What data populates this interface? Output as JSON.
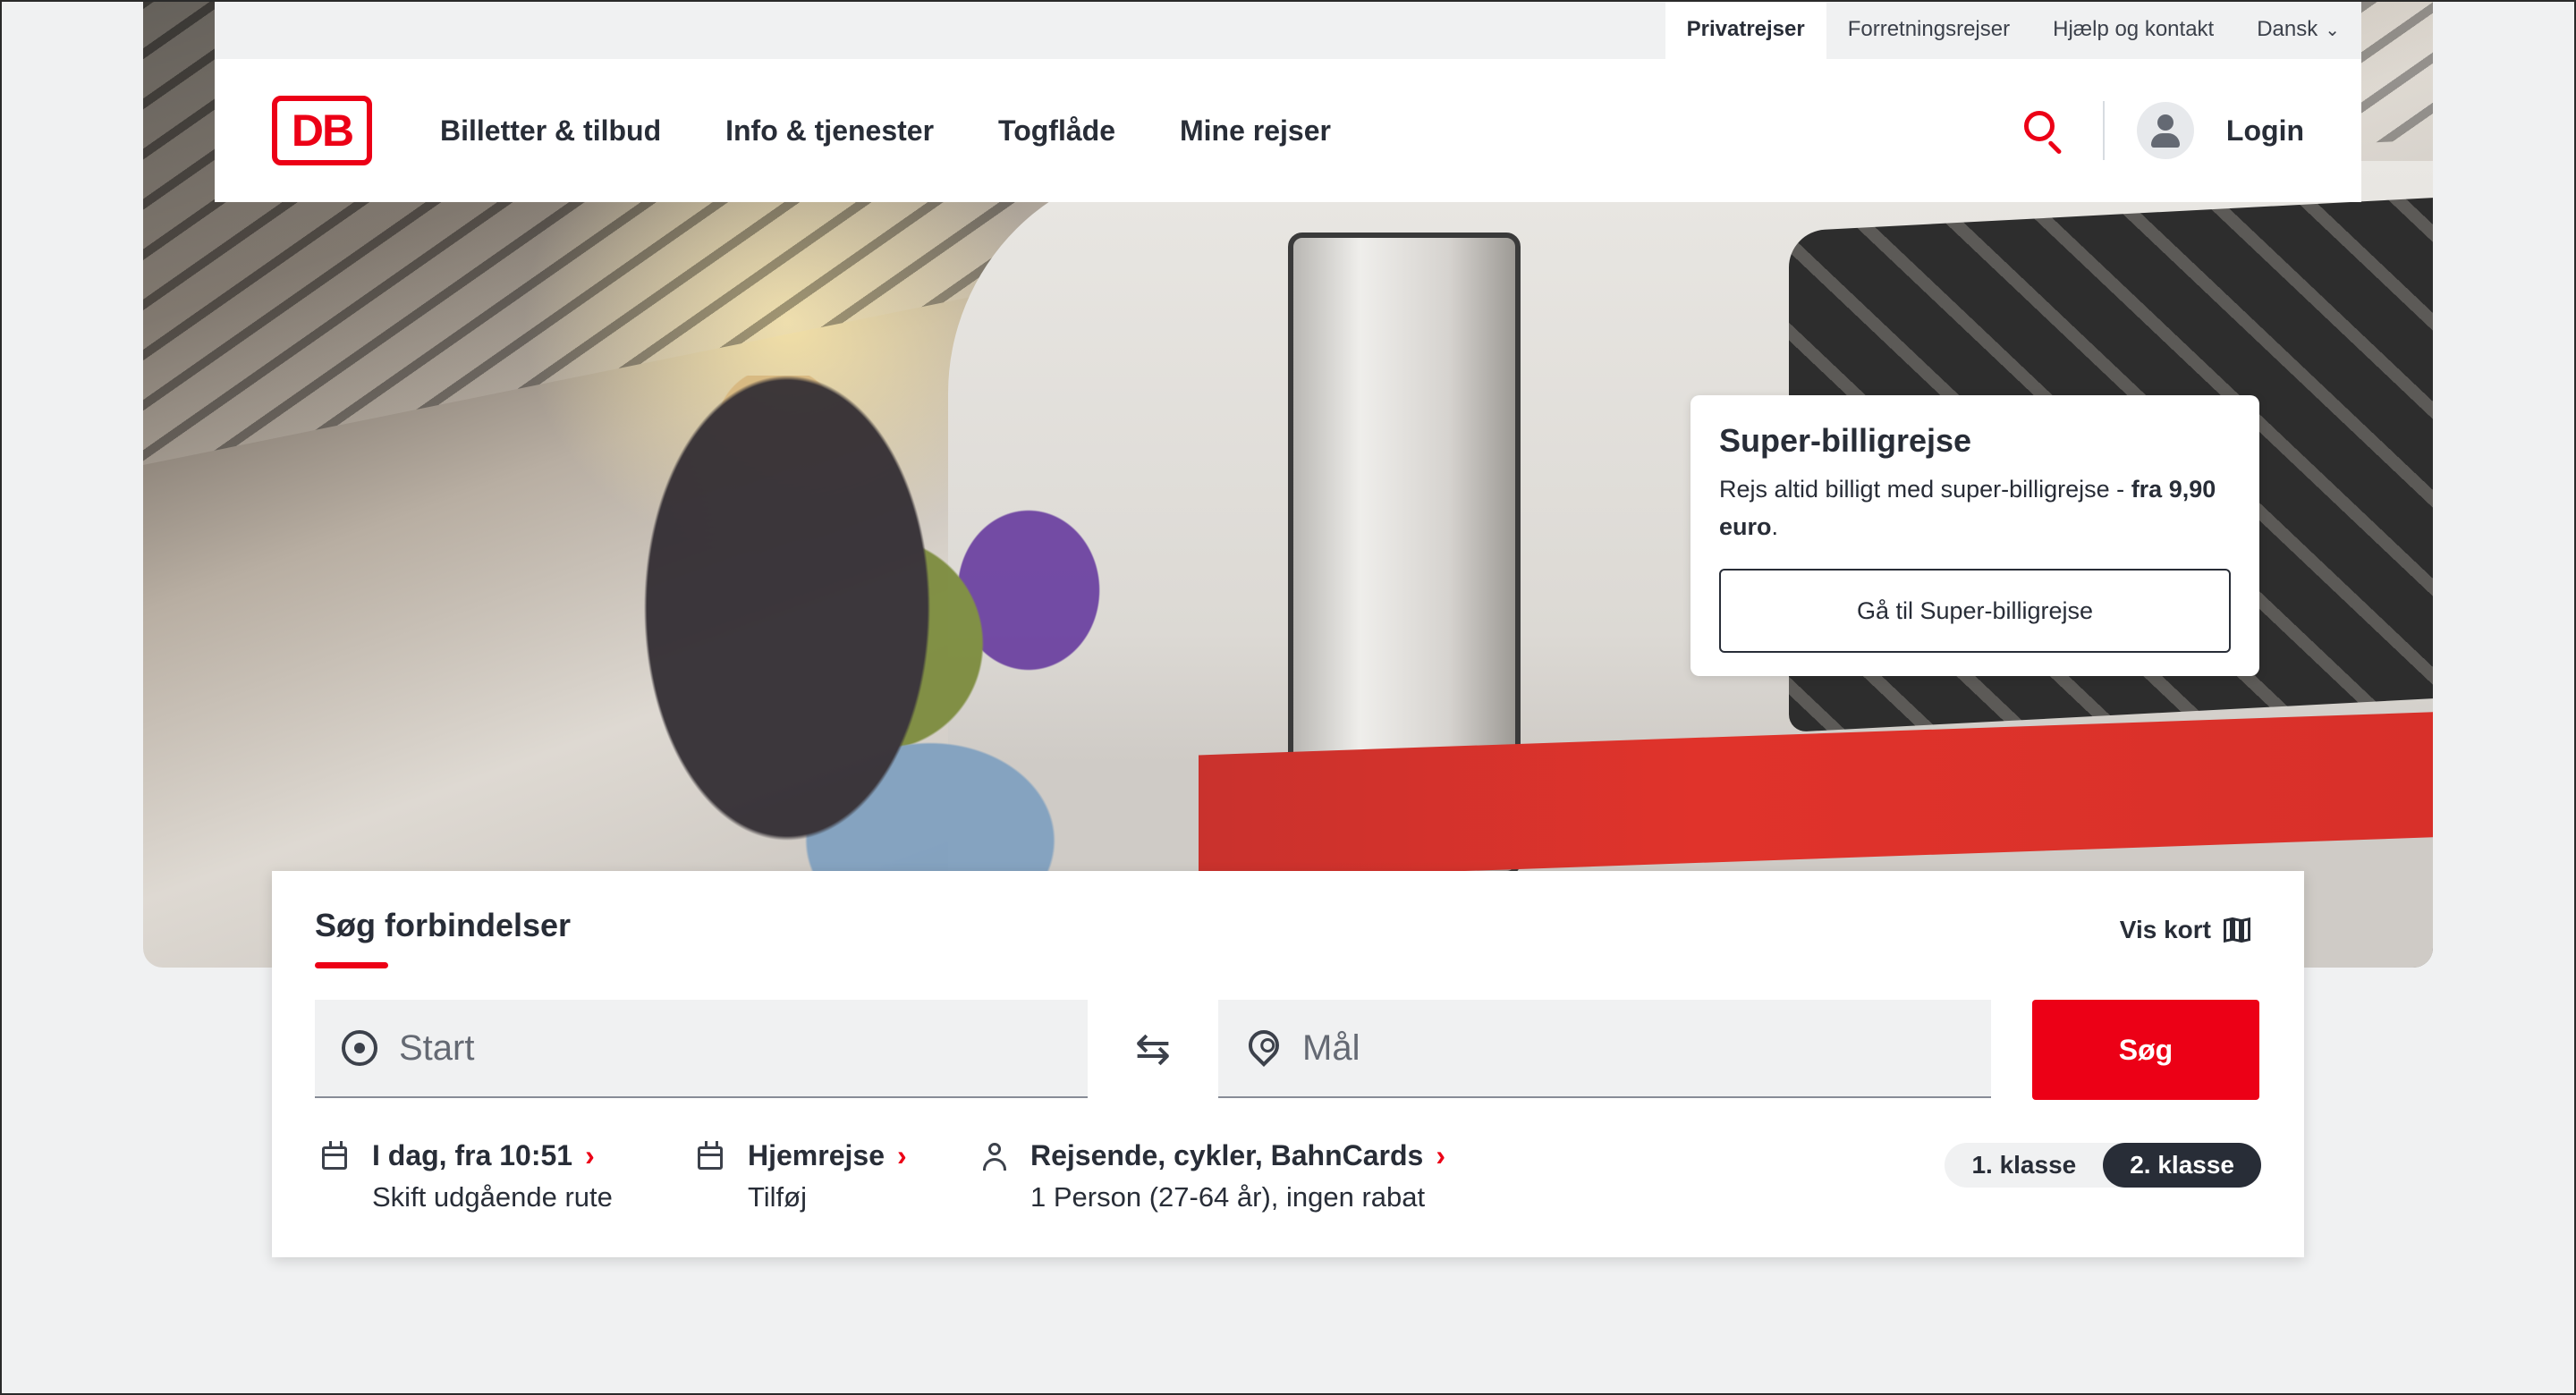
{
  "meta_nav": {
    "items": [
      "Privatrejser",
      "Forretningsrejser",
      "Hjælp og kontakt"
    ],
    "active_index": 0,
    "language": "Dansk"
  },
  "header": {
    "logo": "DB",
    "nav": [
      "Billetter & tilbud",
      "Info & tjenester",
      "Togflåde",
      "Mine rejser"
    ],
    "login": "Login"
  },
  "promo": {
    "title": "Super-billigrejse",
    "text_prefix": "Rejs altid billigt med super-billigrejse - ",
    "text_bold": "fra 9,90 euro",
    "text_suffix": ".",
    "button": "Gå til Super-billigrejse"
  },
  "search": {
    "title": "Søg forbindelser",
    "map_link": "Vis kort",
    "start_placeholder": "Start",
    "dest_placeholder": "Mål",
    "submit": "Søg",
    "options": [
      {
        "main": "I dag, fra 10:51",
        "sub": "Skift udgående rute"
      },
      {
        "main": "Hjemrejse",
        "sub": "Tilføj"
      },
      {
        "main": "Rejsende, cykler, BahnCards",
        "sub": "1 Person (27-64 år), ingen rabat"
      }
    ],
    "classes": [
      "1. klasse",
      "2. klasse"
    ],
    "active_class": 1
  },
  "colors": {
    "brand_red": "#ec0016",
    "text": "#282d37",
    "background": "#f0f1f2"
  }
}
